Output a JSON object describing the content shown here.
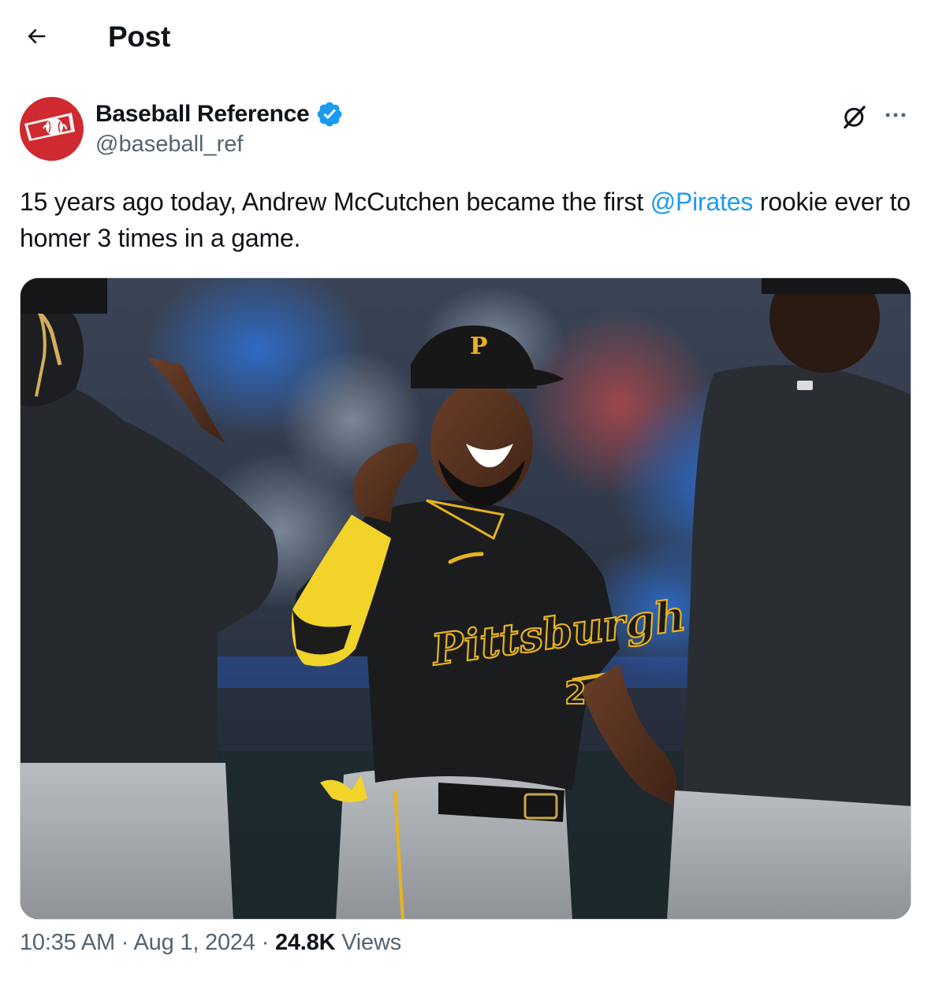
{
  "header": {
    "title": "Post"
  },
  "post": {
    "author": {
      "name": "Baseball Reference",
      "handle": "@baseball_ref",
      "verified": true
    },
    "text": {
      "before_mention": "15 years ago today, Andrew McCutchen became the first ",
      "mention": "@Pirates",
      "after_mention": " rookie ever to homer 3 times in a game."
    },
    "image": {
      "cap_letter": "P",
      "jersey_text": "Pittsburgh",
      "jersey_number": "2"
    },
    "meta": {
      "time": "10:35 AM",
      "date": "Aug 1, 2024",
      "separator": "·",
      "views_count": "24.8K",
      "views_label": "Views"
    }
  },
  "colors": {
    "accent": "#1d9bf0",
    "brand_red": "#cf2a2f",
    "text_primary": "#0f1419",
    "text_secondary": "#536471",
    "pirates_gold": "#fdb827"
  },
  "icons": {
    "back": "arrow-left-icon",
    "verified": "verified-badge-icon",
    "grok": "grok-icon",
    "more": "more-horizontal-icon"
  }
}
